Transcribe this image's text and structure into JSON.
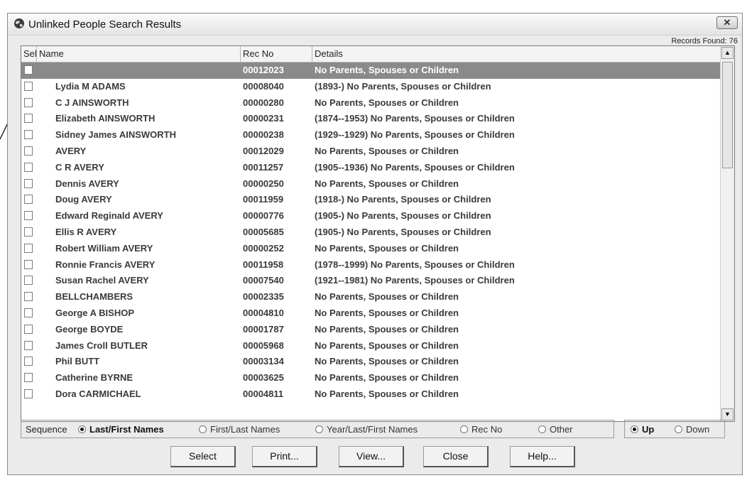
{
  "window": {
    "title": "Unlinked People Search Results",
    "close_label": "✕"
  },
  "records_found": "Records Found: 76",
  "columns": {
    "sel": "Sel",
    "name": "Name",
    "rec_no": "Rec No",
    "details": "Details"
  },
  "rows": [
    {
      "name": "",
      "rec_no": "00012023",
      "details": "No Parents, Spouses or Children"
    },
    {
      "name": "Lydia M ADAMS",
      "rec_no": "00008040",
      "details": "(1893-) No Parents, Spouses or Children"
    },
    {
      "name": "C J AINSWORTH",
      "rec_no": "00000280",
      "details": "No Parents, Spouses or Children"
    },
    {
      "name": "Elizabeth AINSWORTH",
      "rec_no": "00000231",
      "details": "(1874--1953) No Parents, Spouses or Children"
    },
    {
      "name": "Sidney James AINSWORTH",
      "rec_no": "00000238",
      "details": "(1929--1929) No Parents, Spouses or Children"
    },
    {
      "name": "AVERY",
      "rec_no": "00012029",
      "details": "No Parents, Spouses or Children"
    },
    {
      "name": "C R AVERY",
      "rec_no": "00011257",
      "details": "(1905--1936) No Parents, Spouses or Children"
    },
    {
      "name": "Dennis AVERY",
      "rec_no": "00000250",
      "details": "No Parents, Spouses or Children"
    },
    {
      "name": "Doug AVERY",
      "rec_no": "00011959",
      "details": "(1918-) No Parents, Spouses or Children"
    },
    {
      "name": "Edward Reginald AVERY",
      "rec_no": "00000776",
      "details": "(1905-) No Parents, Spouses or Children"
    },
    {
      "name": "Ellis R AVERY",
      "rec_no": "00005685",
      "details": "(1905-) No Parents, Spouses or Children"
    },
    {
      "name": "Robert William AVERY",
      "rec_no": "00000252",
      "details": "No Parents, Spouses or Children"
    },
    {
      "name": "Ronnie Francis AVERY",
      "rec_no": "00011958",
      "details": "(1978--1999) No Parents, Spouses or Children"
    },
    {
      "name": "Susan Rachel AVERY",
      "rec_no": "00007540",
      "details": "(1921--1981) No Parents, Spouses or Children"
    },
    {
      "name": "BELLCHAMBERS",
      "rec_no": "00002335",
      "details": "No Parents, Spouses or Children"
    },
    {
      "name": "George A BISHOP",
      "rec_no": "00004810",
      "details": "No Parents, Spouses or Children"
    },
    {
      "name": "George BOYDE",
      "rec_no": "00001787",
      "details": "No Parents, Spouses or Children"
    },
    {
      "name": "James Croll BUTLER",
      "rec_no": "00005968",
      "details": "No Parents, Spouses or Children"
    },
    {
      "name": "Phil BUTT",
      "rec_no": "00003134",
      "details": "No Parents, Spouses or Children"
    },
    {
      "name": "Catherine BYRNE",
      "rec_no": "00003625",
      "details": "No Parents, Spouses or Children"
    },
    {
      "name": "Dora CARMICHAEL",
      "rec_no": "00004811",
      "details": "No Parents, Spouses or Children"
    }
  ],
  "sequence": {
    "label": "Sequence",
    "options": [
      "Last/First Names",
      "First/Last Names",
      "Year/Last/First Names",
      "Rec No",
      "Other"
    ],
    "selected": "Last/First Names"
  },
  "direction": {
    "options": [
      "Up",
      "Down"
    ],
    "selected": "Up"
  },
  "buttons": {
    "select": "Select",
    "print": "Print...",
    "view": "View...",
    "close": "Close",
    "help": "Help..."
  },
  "colors": {
    "selected_row": "#8a8a8a",
    "window_bg": "#ebebeb"
  }
}
